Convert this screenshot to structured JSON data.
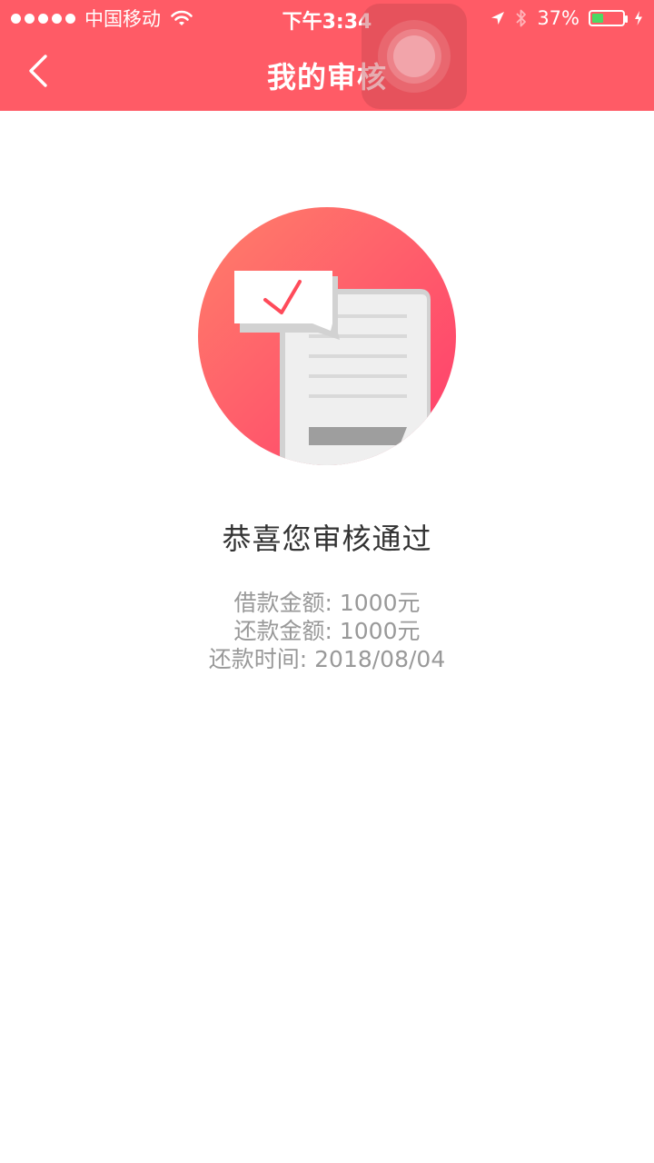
{
  "status_bar": {
    "carrier": "中国移动",
    "time": "下午3:34",
    "battery_percent": "37%",
    "battery_level": 0.37,
    "battery_color": "#4cd964"
  },
  "nav": {
    "back_icon": "chevron-left-icon",
    "title": "我的审核"
  },
  "theme": {
    "accent": "#ff5b66",
    "text_primary": "#333333",
    "text_secondary": "#999999"
  },
  "illustration": {
    "icon": "approved-document-icon"
  },
  "result": {
    "message": "恭喜您审核通过",
    "details": [
      "借款金额: 1000元",
      "还款金额: 1000元",
      "还款时间: 2018/08/04"
    ]
  }
}
